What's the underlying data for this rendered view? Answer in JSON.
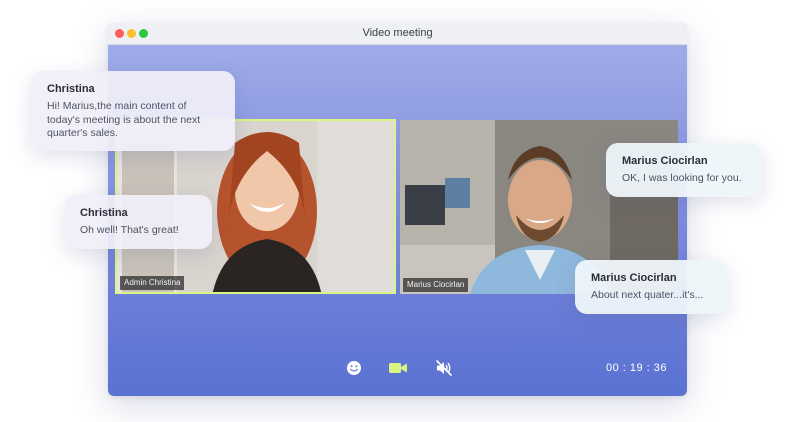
{
  "window": {
    "title": "Video meeting"
  },
  "participants": [
    {
      "name": "Admin Christina",
      "active": true
    },
    {
      "name": "Marius Ciocirlan",
      "active": false
    }
  ],
  "controls": {
    "emoji_icon": "smile-icon",
    "camera_icon": "video-camera-icon",
    "mute_icon": "mute-icon",
    "timer": "00 : 19 : 36"
  },
  "messages": [
    {
      "sender": "Christina",
      "text": "Hi!  Marius,the main content of today's meeting is about the next quarter's sales."
    },
    {
      "sender": "Christina",
      "text": "Oh well!  That's great!"
    },
    {
      "sender": "Marius Ciocirlan",
      "text": "OK, I was looking for you."
    },
    {
      "sender": "Marius Ciocirlan",
      "text": "About next quater...it's..."
    }
  ],
  "colors": {
    "active_border": "#d9f582",
    "camera_icon": "#d9f582",
    "window_gradient_top": "#a4b0ea",
    "window_gradient_bottom": "#5a72d2"
  }
}
